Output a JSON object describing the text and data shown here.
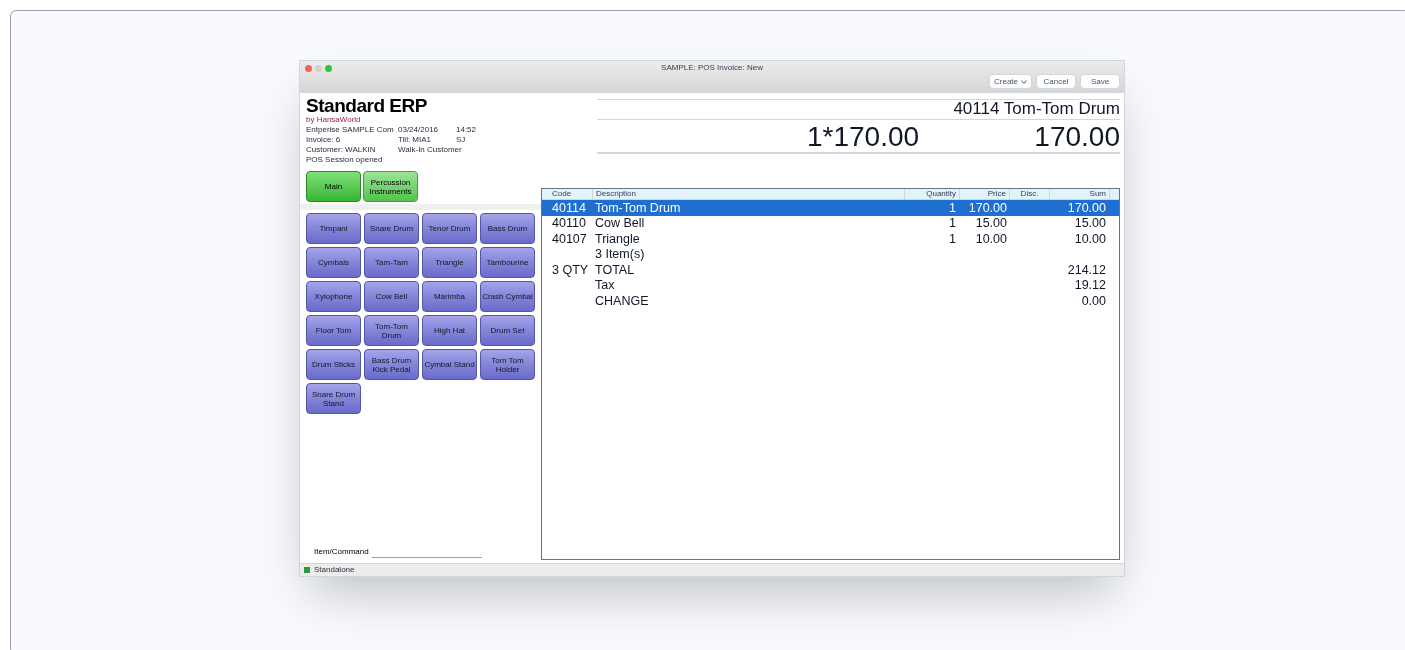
{
  "window": {
    "title": "SAMPLE: POS Invoice: New"
  },
  "toolbar": {
    "create": "Create",
    "cancel": "Cancel",
    "save": "Save"
  },
  "logo": {
    "name": "Standard ERP",
    "byline": "by HansaWorld"
  },
  "info": [
    [
      "Entperise SAMPLE Com",
      "03/24/2016",
      "14:52"
    ],
    [
      "Invoice: 6",
      "Till: MIA1",
      "SJ"
    ],
    [
      "Customer: WALKIN",
      "Walk-In Customer"
    ],
    [
      "POS Session opened"
    ]
  ],
  "display": {
    "item": "40114 Tom-Tom Drum",
    "qty_price": "1*170.00",
    "amount": "170.00"
  },
  "groups": [
    {
      "label": "Main",
      "selected": true
    },
    {
      "label": "Percussion Instruments",
      "selected": false
    }
  ],
  "items": [
    "Timpani",
    "Snare Drum",
    "Tenor Drum",
    "Bass Drum",
    "Cymbals",
    "Tam-Tam",
    "Triangle",
    "Tambourine",
    "Xylophone",
    "Cow Bell",
    "Marimba",
    "Crash Cymbal",
    "Floor Tom",
    "Tom-Tom Drum",
    "High Hat",
    "Drum Set",
    "Drum Sticks",
    "Bass Drum Kick Pedal",
    "Cymbal Stand",
    "Tom Tom Holder",
    "Snare Drum Stand"
  ],
  "command": {
    "label": "Item/Command"
  },
  "table": {
    "columns": [
      "Code",
      "Description",
      "Quantity",
      "Price",
      "Disc.",
      "Sum"
    ],
    "rows": [
      {
        "code": "40114",
        "description": "Tom-Tom Drum",
        "quantity": "1",
        "price": "170.00",
        "sum": "170.00",
        "selected": true
      },
      {
        "code": "40110",
        "description": "Cow Bell",
        "quantity": "1",
        "price": "15.00",
        "sum": "15.00",
        "selected": false
      },
      {
        "code": "40107",
        "description": "Triangle",
        "quantity": "1",
        "price": "10.00",
        "sum": "10.00",
        "selected": false
      },
      {
        "description": "3 Item(s)",
        "selected": false
      },
      {
        "code": "3 QTY",
        "description": "TOTAL",
        "sum": "214.12",
        "selected": false
      },
      {
        "description": "Tax",
        "sum": "19.12",
        "selected": false
      },
      {
        "description": "CHANGE",
        "sum": "0.00",
        "selected": false
      }
    ]
  },
  "status_bar": {
    "text": "Standalone"
  }
}
